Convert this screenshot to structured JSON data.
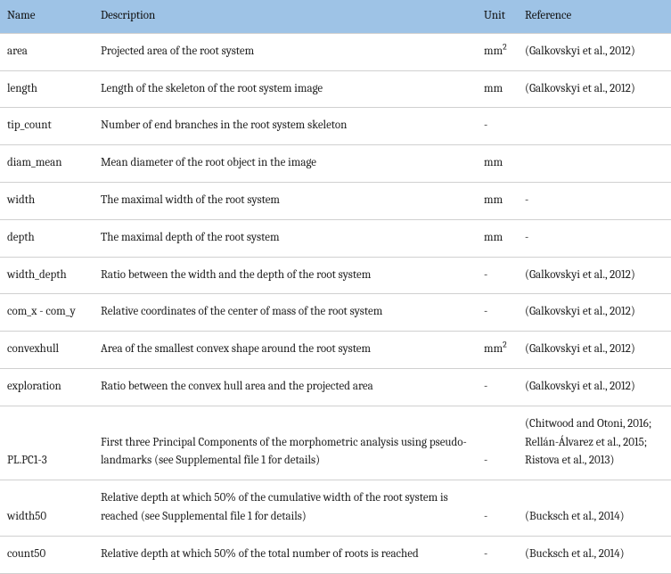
{
  "table": {
    "headers": {
      "name": "Name",
      "description": "Description",
      "unit": "Unit",
      "reference": "Reference"
    },
    "rows": [
      {
        "name": "area",
        "description": "Projected area of the root system",
        "unit": "mm²",
        "reference": "(Galkovskyi et al., 2012)"
      },
      {
        "name": "length",
        "description": "Length of the skeleton of the root system image",
        "unit": "mm",
        "reference": "(Galkovskyi et al., 2012)"
      },
      {
        "name": "tip_count",
        "description": "Number of end branches in the root system skeleton",
        "unit": "-",
        "reference": ""
      },
      {
        "name": "diam_mean",
        "description": "Mean diameter of the root object in the image",
        "unit": "mm",
        "reference": ""
      },
      {
        "name": "width",
        "description": "The maximal width of the root system",
        "unit": "mm",
        "reference": "-"
      },
      {
        "name": "depth",
        "description": "The maximal depth of the root system",
        "unit": "mm",
        "reference": "-"
      },
      {
        "name": "width_depth",
        "description": "Ratio between the width and the depth of the root system",
        "unit": "-",
        "reference": "(Galkovskyi et al., 2012)"
      },
      {
        "name": "com_x - com_y",
        "description": "Relative coordinates of the center of mass of the root system",
        "unit": "-",
        "reference": "(Galkovskyi et al., 2012)"
      },
      {
        "name": "convexhull",
        "description": "Area of the smallest convex shape around the root system",
        "unit": "mm²",
        "reference": "(Galkovskyi et al., 2012)"
      },
      {
        "name": "exploration",
        "description": "Ratio between the convex hull area and the projected area",
        "unit": "-",
        "reference": "(Galkovskyi et al., 2012)"
      },
      {
        "name": "PL.PC1-3",
        "description": "First three Principal Components of the morphometric analysis using pseudo-landmarks (see Supplemental file 1 for details)",
        "unit": "-",
        "reference": "(Chitwood and Otoni, 2016; Rellán-Álvarez et al., 2015; Ristova et al., 2013)"
      },
      {
        "name": "width50",
        "description": "Relative depth at which 50% of the cumulative width of the root system is reached (see Supplemental file 1 for details)",
        "unit": "-",
        "reference": "(Bucksch et al., 2014)"
      },
      {
        "name": "count50",
        "description": "Relative depth at which 50% of the total number of roots is reached",
        "unit": "-",
        "reference": "(Bucksch et al., 2014)"
      }
    ]
  }
}
